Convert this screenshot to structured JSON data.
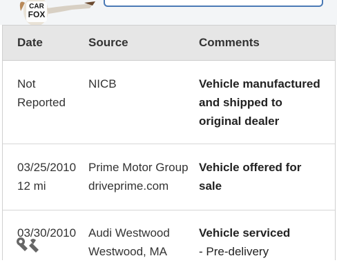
{
  "header": {
    "mascot_text_line1": "CAR",
    "mascot_text_line2": "FOX"
  },
  "table": {
    "columns": [
      "Date",
      "Source",
      "Comments"
    ],
    "rows": [
      {
        "date_line1": "Not",
        "date_line2": "Reported",
        "source_line1": "NICB",
        "source_line2": "",
        "comment_line1": "Vehicle manufactured",
        "comment_line2": "and shipped to",
        "comment_line3": "original dealer"
      },
      {
        "date_line1": "03/25/2010",
        "date_line2": "12 mi",
        "source_line1": "Prime Motor Group",
        "source_line2": "driveprime.com",
        "comment_line1": "Vehicle offered for",
        "comment_line2": "sale",
        "comment_line3": ""
      },
      {
        "date_line1": "03/30/2010",
        "date_line2": "",
        "source_line1": "Audi Westwood",
        "source_line2": "Westwood, MA",
        "comment_line1": "Vehicle serviced",
        "comment_line2": "- Pre-delivery",
        "comment_line3": ""
      }
    ]
  },
  "icons": {
    "service": "wrench-icon"
  }
}
